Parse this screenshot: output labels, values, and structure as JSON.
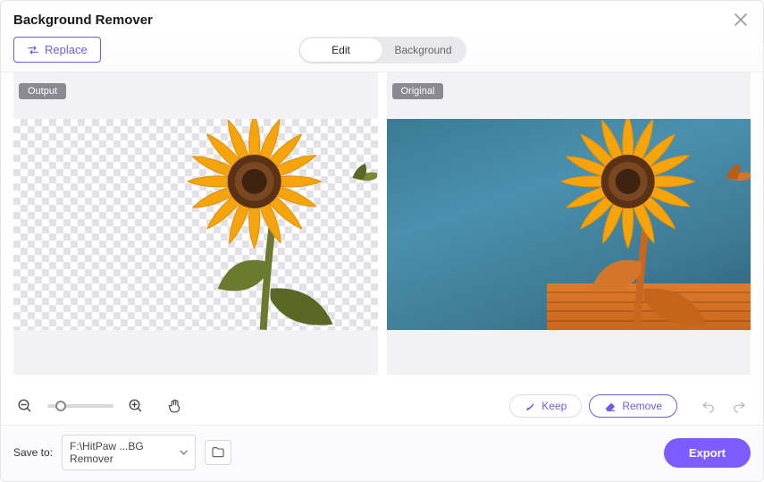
{
  "title": "Background Remover",
  "replace_label": "Replace",
  "tabs": {
    "edit": "Edit",
    "background": "Background"
  },
  "panels": {
    "output_tag": "Output",
    "original_tag": "Original"
  },
  "actions": {
    "keep": "Keep",
    "remove": "Remove"
  },
  "footer": {
    "save_to": "Save to:",
    "path": "F:\\HitPaw ...BG Remover",
    "export": "Export"
  },
  "zoom_percent": 20
}
